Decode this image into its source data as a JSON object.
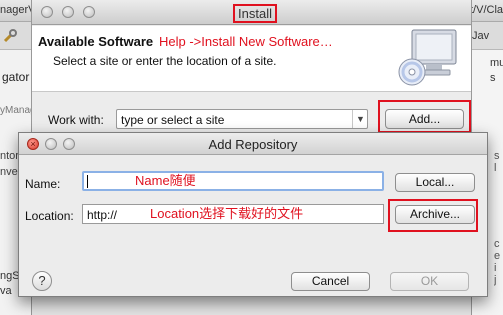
{
  "background": {
    "tab_left": "nagerV",
    "tab_right": "t/V/Clas",
    "toolbar_right": "Jav",
    "left_panel": [
      "gator",
      "yManag",
      "ntor",
      "nver",
      "ngS",
      "va"
    ],
    "right_panel": [
      "mu",
      "s"
    ],
    "right_edge": [
      "s",
      "l",
      "c",
      "e",
      "i",
      "j"
    ]
  },
  "install": {
    "title": "Install",
    "header_title": "Available Software",
    "header_annotation": "Help ->Install New Software…",
    "header_subtitle": "Select a site or enter the location of a site.",
    "work_with_label": "Work with:",
    "site_placeholder": "type or select a site",
    "add_button": "Add..."
  },
  "dialog": {
    "title": "Add Repository",
    "name_label": "Name:",
    "name_value": "",
    "name_annotation": "Name随便",
    "location_label": "Location:",
    "location_value": "http://",
    "location_annotation": "Location选择下载好的文件",
    "local_button": "Local...",
    "archive_button": "Archive...",
    "help_button": "?",
    "cancel_button": "Cancel",
    "ok_button": "OK"
  },
  "colors": {
    "annotation": "#e0111f",
    "focus_ring": "#8bb1e6",
    "close_button": "#d83a2b"
  }
}
